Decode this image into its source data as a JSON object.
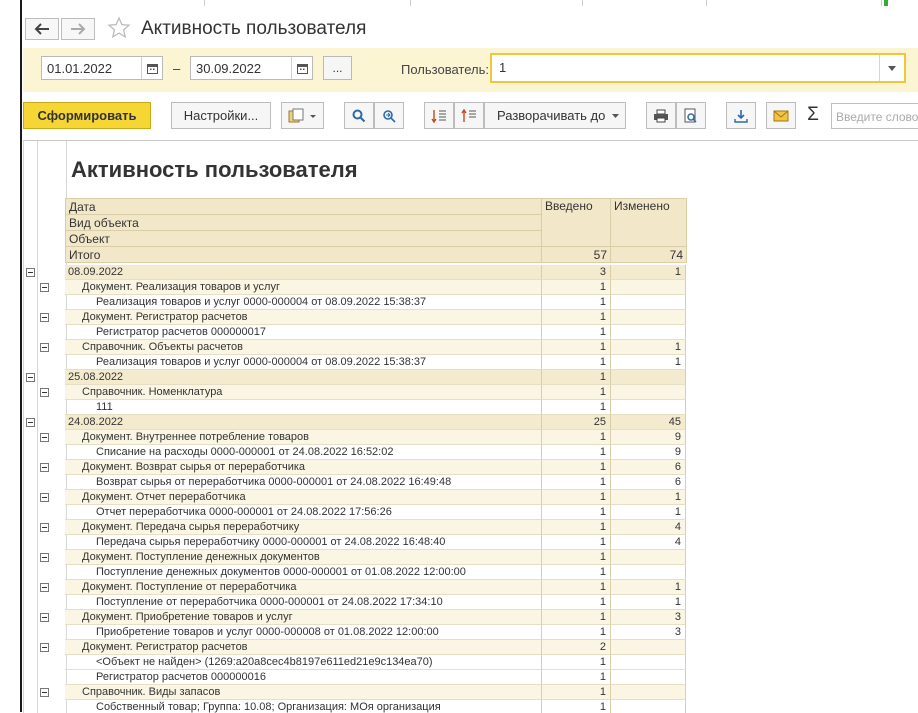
{
  "window": {
    "title": "Активность пользователя"
  },
  "filters": {
    "date_from": "01.01.2022",
    "date_sep": "–",
    "date_to": "30.09.2022",
    "more_label": "...",
    "user_label": "Пользователь:",
    "user_value": "1"
  },
  "toolbar": {
    "generate_label": "Сформировать",
    "settings_label": "Настройки...",
    "expand_label": "Разворачивать до",
    "sum_glyph": "Σ",
    "search_placeholder": "Введите слово"
  },
  "report": {
    "title": "Активность пользователя",
    "headers": {
      "date": "Дата",
      "object_kind": "Вид объекта",
      "object": "Объект",
      "entered": "Введено",
      "changed": "Изменено",
      "total_label": "Итого",
      "total_entered": "57",
      "total_changed": "74"
    },
    "rows": [
      {
        "level": 0,
        "label": "08.09.2022",
        "entered": "3",
        "changed": "1"
      },
      {
        "level": 1,
        "label": "Документ. Реализация товаров и услуг",
        "entered": "1",
        "changed": ""
      },
      {
        "level": 2,
        "label": "Реализация товаров и услуг 0000-000004 от 08.09.2022 15:38:37",
        "entered": "1",
        "changed": ""
      },
      {
        "level": 1,
        "label": "Документ. Регистратор расчетов",
        "entered": "1",
        "changed": ""
      },
      {
        "level": 2,
        "label": "Регистратор расчетов 000000017",
        "entered": "1",
        "changed": ""
      },
      {
        "level": 1,
        "label": "Справочник. Объекты расчетов",
        "entered": "1",
        "changed": "1"
      },
      {
        "level": 2,
        "label": "Реализация товаров и услуг 0000-000004 от 08.09.2022 15:38:37",
        "entered": "1",
        "changed": "1"
      },
      {
        "level": 0,
        "label": "25.08.2022",
        "entered": "1",
        "changed": ""
      },
      {
        "level": 1,
        "label": "Справочник. Номенклатура",
        "entered": "1",
        "changed": ""
      },
      {
        "level": 2,
        "label": "111",
        "entered": "1",
        "changed": ""
      },
      {
        "level": 0,
        "label": "24.08.2022",
        "entered": "25",
        "changed": "45"
      },
      {
        "level": 1,
        "label": "Документ. Внутреннее потребление товаров",
        "entered": "1",
        "changed": "9"
      },
      {
        "level": 2,
        "label": "Списание на расходы 0000-000001 от 24.08.2022 16:52:02",
        "entered": "1",
        "changed": "9"
      },
      {
        "level": 1,
        "label": "Документ. Возврат сырья от переработчика",
        "entered": "1",
        "changed": "6"
      },
      {
        "level": 2,
        "label": "Возврат сырья от переработчика 0000-000001 от 24.08.2022 16:49:48",
        "entered": "1",
        "changed": "6"
      },
      {
        "level": 1,
        "label": "Документ. Отчет переработчика",
        "entered": "1",
        "changed": "1"
      },
      {
        "level": 2,
        "label": "Отчет переработчика 0000-000001 от 24.08.2022 17:56:26",
        "entered": "1",
        "changed": "1"
      },
      {
        "level": 1,
        "label": "Документ. Передача сырья переработчику",
        "entered": "1",
        "changed": "4"
      },
      {
        "level": 2,
        "label": "Передача сырья переработчику 0000-000001 от 24.08.2022 16:48:40",
        "entered": "1",
        "changed": "4"
      },
      {
        "level": 1,
        "label": "Документ. Поступление денежных документов",
        "entered": "1",
        "changed": ""
      },
      {
        "level": 2,
        "label": "Поступление денежных документов 0000-000001 от 01.08.2022 12:00:00",
        "entered": "1",
        "changed": ""
      },
      {
        "level": 1,
        "label": "Документ. Поступление от переработчика",
        "entered": "1",
        "changed": "1"
      },
      {
        "level": 2,
        "label": "Поступление от переработчика 0000-000001 от 24.08.2022 17:34:10",
        "entered": "1",
        "changed": "1"
      },
      {
        "level": 1,
        "label": "Документ. Приобретение товаров и услуг",
        "entered": "1",
        "changed": "3"
      },
      {
        "level": 2,
        "label": "Приобретение товаров и услуг 0000-000008 от 01.08.2022 12:00:00",
        "entered": "1",
        "changed": "3"
      },
      {
        "level": 1,
        "label": "Документ. Регистратор расчетов",
        "entered": "2",
        "changed": ""
      },
      {
        "level": 2,
        "label": "<Объект не найден> (1269:a20a8cec4b8197e611ed21e9c134ea70)",
        "entered": "1",
        "changed": ""
      },
      {
        "level": 2,
        "label": "Регистратор расчетов 000000016",
        "entered": "1",
        "changed": ""
      },
      {
        "level": 1,
        "label": "Справочник. Виды запасов",
        "entered": "1",
        "changed": ""
      },
      {
        "level": 2,
        "label": "Собственный товар; Группа: 10.08; Организация: МОя организация",
        "entered": "1",
        "changed": ""
      }
    ]
  }
}
